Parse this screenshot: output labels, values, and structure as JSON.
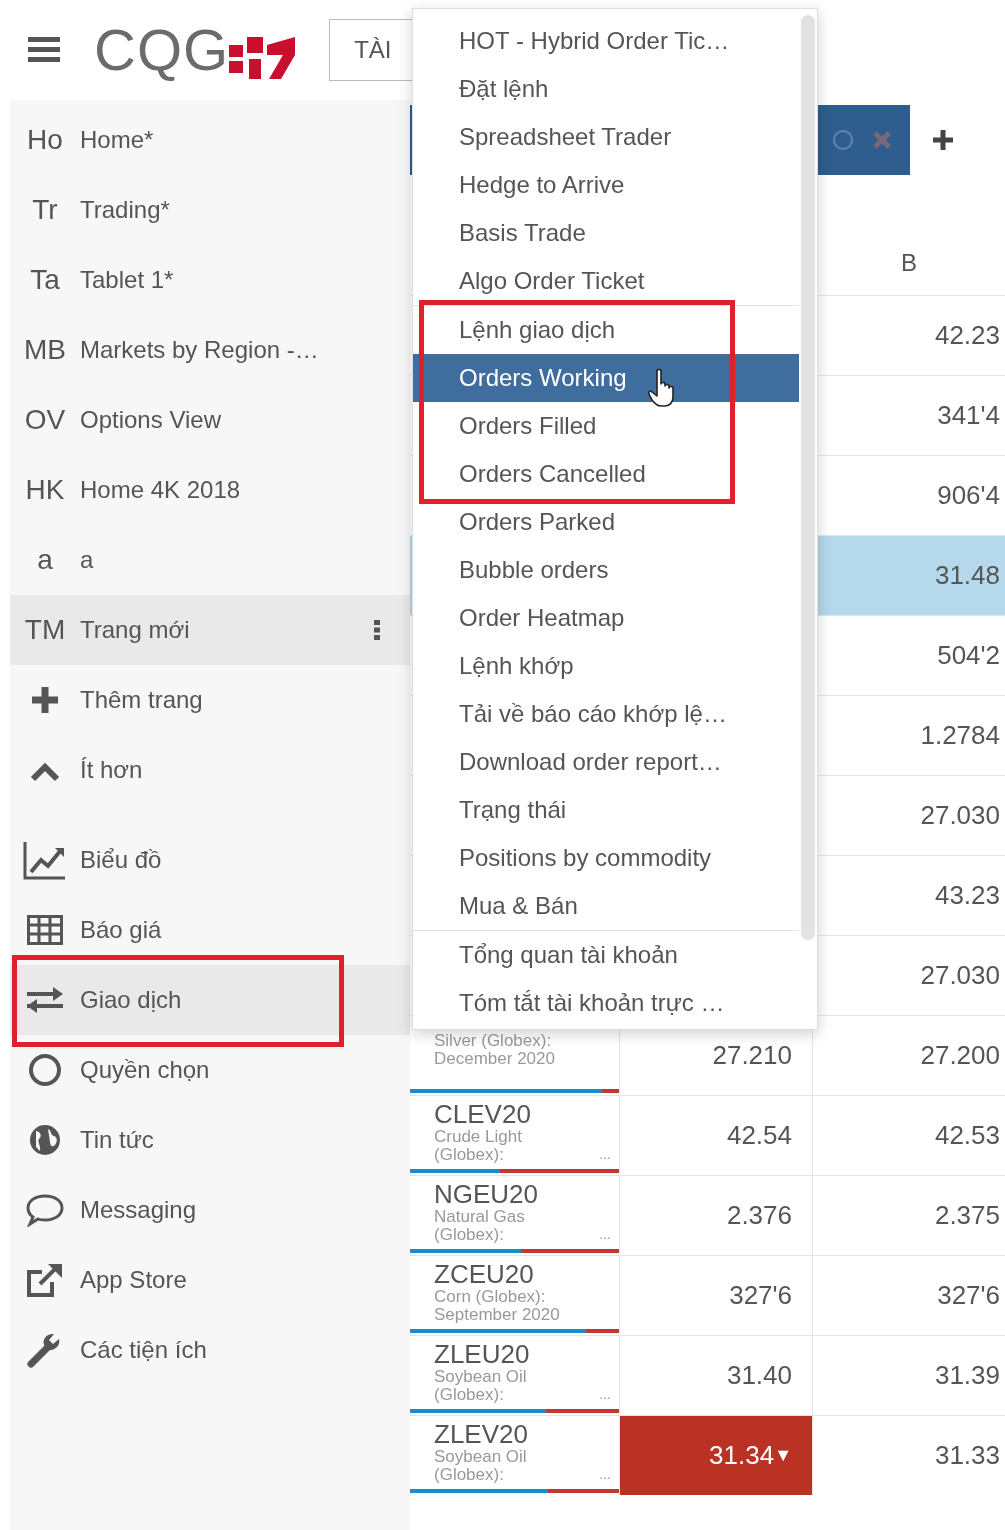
{
  "header": {
    "logo": "CQG",
    "account_button": "TÀI"
  },
  "sidebar": {
    "pages": [
      {
        "abbr": "Ho",
        "label": "Home*",
        "selected": false
      },
      {
        "abbr": "Tr",
        "label": "Trading*",
        "selected": false
      },
      {
        "abbr": "Ta",
        "label": "Tablet 1*",
        "selected": false
      },
      {
        "abbr": "MB",
        "label": "Markets by Region -…",
        "selected": false
      },
      {
        "abbr": "OV",
        "label": "Options View",
        "selected": false
      },
      {
        "abbr": "HK",
        "label": "Home 4K 2018",
        "selected": false
      },
      {
        "abbr": "a",
        "label": "a",
        "selected": false
      },
      {
        "abbr": "TM",
        "label": "Trang mới",
        "selected": true
      }
    ],
    "page_actions": [
      {
        "label": "Thêm trang"
      },
      {
        "label": "Ít hơn"
      }
    ],
    "tools": [
      {
        "label": "Biểu đồ",
        "selected": false,
        "outlined": false
      },
      {
        "label": "Báo giá",
        "selected": false,
        "outlined": false
      },
      {
        "label": "Giao dịch",
        "selected": true,
        "outlined": true
      },
      {
        "label": "Quyền chọn",
        "selected": false,
        "outlined": false
      },
      {
        "label": "Tin tức",
        "selected": false,
        "outlined": false
      },
      {
        "label": "Messaging",
        "selected": false,
        "outlined": false
      },
      {
        "label": "App Store",
        "selected": false,
        "outlined": false
      },
      {
        "label": "Các tiện ích",
        "selected": false,
        "outlined": false
      }
    ]
  },
  "menu": {
    "sections": [
      {
        "items": [
          {
            "label": "HOT - Hybrid Order Tic…",
            "selected": false,
            "outlined": false
          },
          {
            "label": "Đặt lệnh",
            "selected": false,
            "outlined": false
          },
          {
            "label": "Spreadsheet Trader",
            "selected": false,
            "outlined": false
          },
          {
            "label": "Hedge to Arrive",
            "selected": false,
            "outlined": false
          },
          {
            "label": "Basis Trade",
            "selected": false,
            "outlined": false
          },
          {
            "label": "Algo Order Ticket",
            "selected": false,
            "outlined": false
          }
        ]
      },
      {
        "items": [
          {
            "label": "Lệnh giao dịch",
            "selected": false,
            "outlined": true
          },
          {
            "label": "Orders Working",
            "selected": true,
            "outlined": true
          },
          {
            "label": "Orders Filled",
            "selected": false,
            "outlined": true
          },
          {
            "label": "Orders Cancelled",
            "selected": false,
            "outlined": true
          },
          {
            "label": "Orders Parked",
            "selected": false,
            "outlined": false
          },
          {
            "label": "Bubble orders",
            "selected": false,
            "outlined": false
          },
          {
            "label": "Order Heatmap",
            "selected": false,
            "outlined": false
          },
          {
            "label": "Lệnh khớp",
            "selected": false,
            "outlined": false
          },
          {
            "label": "Tải về báo cáo khớp lệ…",
            "selected": false,
            "outlined": false
          },
          {
            "label": "Download order report…",
            "selected": false,
            "outlined": false
          },
          {
            "label": "Trạng thái",
            "selected": false,
            "outlined": false
          },
          {
            "label": "Positions by commodity",
            "selected": false,
            "outlined": false
          },
          {
            "label": "Mua & Bán",
            "selected": false,
            "outlined": false
          }
        ]
      },
      {
        "items": [
          {
            "label": "Tổng quan tài khoản",
            "selected": false,
            "outlined": false
          },
          {
            "label": "Tóm tắt tài khoản trực …",
            "selected": false,
            "outlined": false
          }
        ]
      }
    ]
  },
  "table": {
    "column_3": "B",
    "rows": [
      {
        "column_3": "42.23",
        "selected": false
      },
      {
        "column_3": "341'4",
        "selected": false
      },
      {
        "column_3": "906'4",
        "selected": false
      },
      {
        "column_3": "31.48",
        "selected": true
      },
      {
        "column_3": "504'2",
        "selected": false
      },
      {
        "column_3": "1.2784",
        "selected": false
      },
      {
        "column_3": "27.030",
        "selected": false
      },
      {
        "column_3": "43.23",
        "selected": false
      },
      {
        "column_3": "27.030",
        "selected": false
      },
      {
        "description": "Silver (Globex): December 2020",
        "column_2": "27.210",
        "flashing": false,
        "column_3": "27.200",
        "selected": false,
        "level": 0.92
      },
      {
        "symbol": "CLEV20",
        "description": "Crude Light (Globex):",
        "ellipsis": "...",
        "column_2": "42.54",
        "flashing": false,
        "column_3": "42.53",
        "selected": false,
        "level": 0.43
      },
      {
        "symbol": "NGEU20",
        "description": "Natural Gas (Globex):",
        "ellipsis": "...",
        "column_2": "2.376",
        "flashing": false,
        "column_3": "2.375",
        "selected": false,
        "level": 0.53
      },
      {
        "symbol": "ZCEU20",
        "description": "Corn (Globex): September 2020",
        "column_2": "327'6",
        "flashing": false,
        "column_3": "327'6",
        "selected": false,
        "level": 0.84
      },
      {
        "symbol": "ZLEU20",
        "description": "Soybean Oil (Globex):",
        "ellipsis": "...",
        "column_2": "31.40",
        "flashing": false,
        "column_3": "31.39",
        "selected": false,
        "level": 0.65
      },
      {
        "symbol": "ZLEV20",
        "description": "Soybean Oil (Globex):",
        "ellipsis": "...",
        "column_2": "31.34",
        "arrow": "▼",
        "flashing": true,
        "column_3": "31.33",
        "selected": false,
        "level": 0.66
      }
    ]
  }
}
